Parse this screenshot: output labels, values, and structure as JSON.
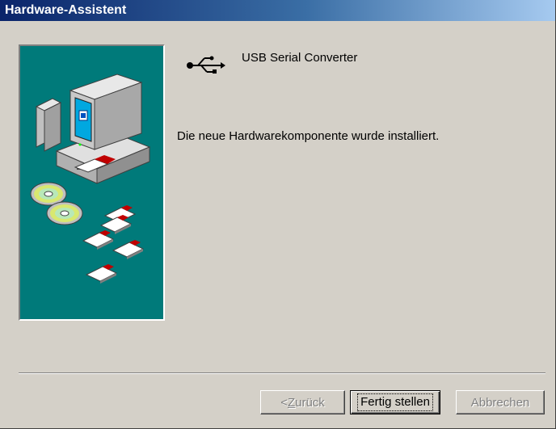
{
  "window": {
    "title": "Hardware-Assistent"
  },
  "content": {
    "device_icon": "usb-icon",
    "device_name": "USB Serial Converter",
    "message": "Die neue Hardwarekomponente wurde installiert."
  },
  "buttons": {
    "back_prefix": "< ",
    "back_mnemonic": "Z",
    "back_rest": "urück",
    "finish_label": "Fertig stellen",
    "cancel_label": "Abbrechen"
  },
  "colors": {
    "titlebar_start": "#0a246a",
    "titlebar_end": "#a6caf0",
    "panel_bg": "#d4d0c8",
    "wizard_bg": "#007a7a"
  }
}
